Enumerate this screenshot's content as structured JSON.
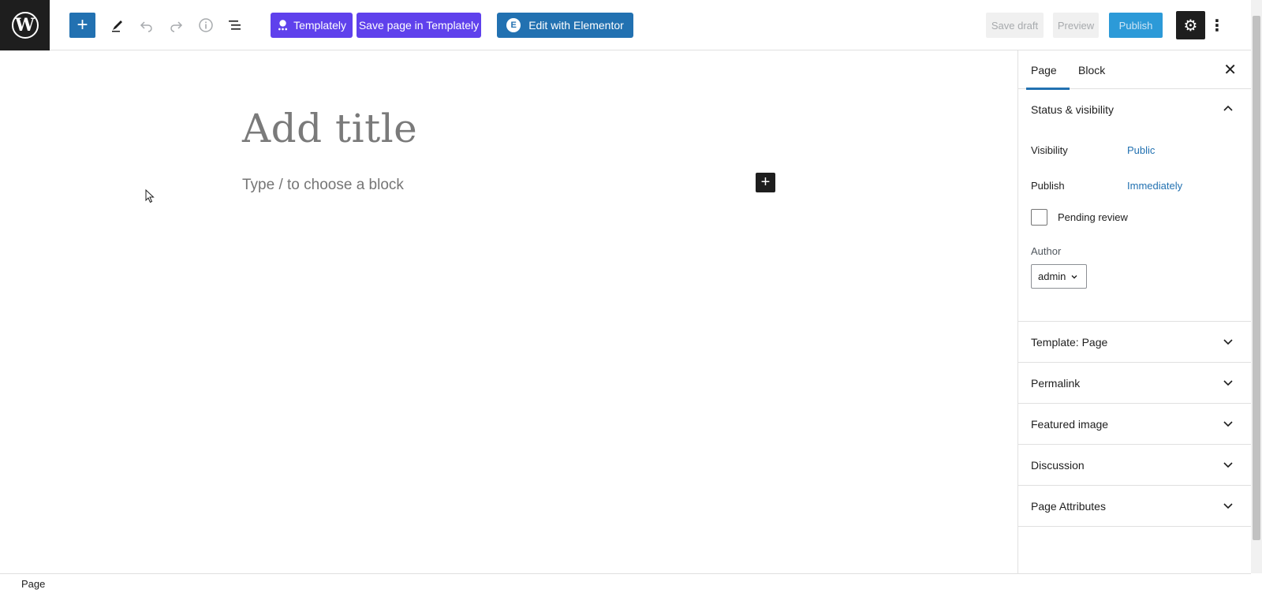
{
  "toolbar": {
    "templately_label": "Templately",
    "save_templately_label": "Save page in Templately",
    "elementor_label": "Edit with Elementor",
    "save_draft_label": "Save draft",
    "preview_label": "Preview",
    "publish_label": "Publish"
  },
  "editor": {
    "title_placeholder": "Add title",
    "block_placeholder": "Type / to choose a block"
  },
  "sidebar": {
    "tabs": [
      "Page",
      "Block"
    ],
    "status": {
      "heading": "Status & visibility",
      "visibility_label": "Visibility",
      "visibility_value": "Public",
      "publish_label": "Publish",
      "publish_value": "Immediately",
      "pending_label": "Pending review",
      "author_label": "Author",
      "author_value": "admin"
    },
    "panels": [
      "Template: Page",
      "Permalink",
      "Featured image",
      "Discussion",
      "Page Attributes"
    ]
  },
  "footer": {
    "breadcrumb": "Page"
  },
  "colors": {
    "accent": "#2271b1",
    "templately": "#5f41ec",
    "dark": "#1e1e1e"
  }
}
